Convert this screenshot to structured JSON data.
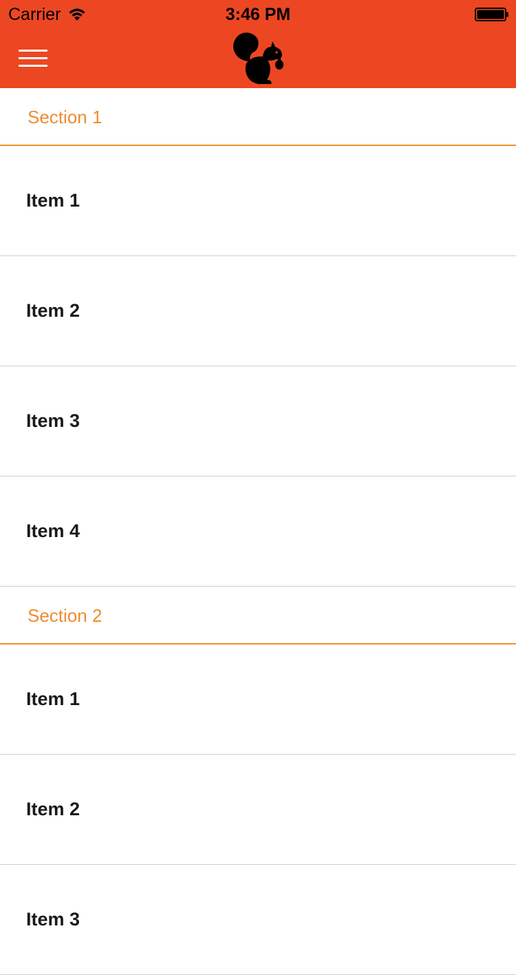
{
  "status_bar": {
    "carrier": "Carrier",
    "time": "3:46 PM"
  },
  "colors": {
    "header_bg": "#ec4722",
    "section_accent": "#ef8c30",
    "divider": "#cfcfcf"
  },
  "nav": {
    "menu_icon": "hamburger-menu-icon",
    "logo_icon": "squirrel-logo-icon"
  },
  "sections": [
    {
      "title": "Section 1",
      "items": [
        "Item 1",
        "Item 2",
        "Item 3",
        "Item 4"
      ]
    },
    {
      "title": "Section 2",
      "items": [
        "Item 1",
        "Item 2",
        "Item 3"
      ]
    }
  ]
}
